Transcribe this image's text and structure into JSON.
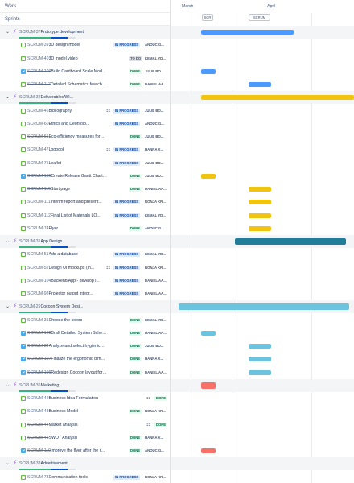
{
  "header": {
    "work_label": "Work",
    "sprints_label": "Sprints"
  },
  "timeline": {
    "months": [
      "March",
      "April"
    ],
    "sprints": [
      "SCR",
      "SCRUM"
    ]
  },
  "rows": [
    {
      "kind": "epic",
      "key": "SCRUM-37",
      "title": "Prototype development",
      "color": "#4c9aff"
    },
    {
      "kind": "story",
      "key": "SCRUM-39",
      "title": "3D design model",
      "status": "IN PROGRESS",
      "status_class": "inprogress",
      "assignee": "ANOUC G..."
    },
    {
      "kind": "story",
      "key": "SCRUM-40",
      "title": "3D model video",
      "status": "TO DO",
      "status_class": "todo",
      "assignee": "KEMAL YD..."
    },
    {
      "kind": "task",
      "key": "SCRUM-109",
      "title": "Build Cardboard Scale Mod...",
      "status": "DONE",
      "status_class": "done",
      "assignee": "JULIE BO...",
      "done": true
    },
    {
      "kind": "story",
      "key": "SCRUM-117",
      "title": "Detailed Schematics few chang...",
      "status": "DONE",
      "status_class": "done",
      "assignee": "DANIEL AA...",
      "done": true
    },
    {
      "kind": "epic",
      "key": "SCRUM-32",
      "title": "Deliverables/Wi...",
      "color": "#f1c40f"
    },
    {
      "kind": "story",
      "key": "SCRUM-46",
      "title": "Bibliography",
      "status": "IN PROGRESS",
      "status_class": "inprogress",
      "assignee": "JULIE BO...",
      "children": true
    },
    {
      "kind": "story",
      "key": "SCRUM-60",
      "title": "Ethics and Deontolo...",
      "status": "IN PROGRESS",
      "status_class": "inprogress",
      "assignee": "ANOUC G..."
    },
    {
      "kind": "story",
      "key": "SCRUM-61",
      "title": "Eco-efficiency measures for Sustai...",
      "status": "DONE",
      "status_class": "done",
      "assignee": "JULIE BO...",
      "done": true
    },
    {
      "kind": "story",
      "key": "SCRUM-47",
      "title": "Logbook",
      "status": "IN PROGRESS",
      "status_class": "inprogress",
      "assignee": "HANNA K...",
      "children": true
    },
    {
      "kind": "story",
      "key": "SCRUM-75",
      "title": "Leaflet",
      "status": "IN PROGRESS",
      "status_class": "inprogress",
      "assignee": "JULIE BO..."
    },
    {
      "kind": "task",
      "key": "SCRUM-105",
      "title": "Create Release Gantt Chart & Sp...",
      "status": "DONE",
      "status_class": "done",
      "assignee": "JULIE BO...",
      "done": true
    },
    {
      "kind": "story",
      "key": "SCRUM-115",
      "title": "Start page",
      "status": "DONE",
      "status_class": "done",
      "assignee": "DANIEL AA...",
      "done": true
    },
    {
      "kind": "story",
      "key": "SCRUM-111",
      "title": "Interim report and present...",
      "status": "IN PROGRESS",
      "status_class": "inprogress",
      "assignee": "RONJA KR..."
    },
    {
      "kind": "story",
      "key": "SCRUM-112",
      "title": "Final List of Materials LO...",
      "status": "IN PROGRESS",
      "status_class": "inprogress",
      "assignee": "KEMAL YD..."
    },
    {
      "kind": "story",
      "key": "SCRUM-74",
      "title": "Flyer",
      "status": "DONE",
      "status_class": "done",
      "assignee": "ANOUC G..."
    },
    {
      "kind": "epic",
      "key": "SCRUM-31",
      "title": "App Design",
      "color": "#227d9b"
    },
    {
      "kind": "story",
      "key": "SCRUM-51",
      "title": "Add a database",
      "status": "IN PROGRESS",
      "status_class": "inprogress",
      "assignee": "KEMAL YD..."
    },
    {
      "kind": "story",
      "key": "SCRUM-52",
      "title": "Design UI mockups (in...",
      "status": "IN PROGRESS",
      "status_class": "inprogress",
      "assignee": "RONJA KR...",
      "children": true
    },
    {
      "kind": "story",
      "key": "SCRUM-104",
      "title": "Backend App - develop l...",
      "status": "IN PROGRESS",
      "status_class": "inprogress",
      "assignee": "DANIEL AA..."
    },
    {
      "kind": "story",
      "key": "SCRUM-98",
      "title": "Projector output integr...",
      "status": "IN PROGRESS",
      "status_class": "inprogress",
      "assignee": "DANIEL AA..."
    },
    {
      "kind": "epic",
      "key": "SCRUM-29",
      "title": "Cocoon System Desi...",
      "color": "#6cc3e0"
    },
    {
      "kind": "story",
      "key": "SCRUM-35",
      "title": "Choose the colors",
      "status": "DONE",
      "status_class": "done",
      "assignee": "KEMAL YD...",
      "done": true
    },
    {
      "kind": "task",
      "key": "SCRUM-108",
      "title": "Draft Detailed System Schemat...",
      "status": "DONE",
      "status_class": "done",
      "assignee": "DANIEL AA...",
      "done": true
    },
    {
      "kind": "task",
      "key": "SCRUM-34",
      "title": "Analyze and select hygienic/acous...",
      "status": "DONE",
      "status_class": "done",
      "assignee": "JULIE BO...",
      "done": true
    },
    {
      "kind": "task",
      "key": "SCRUM-107",
      "title": "Finalize the ergonomic dimensions",
      "status": "DONE",
      "status_class": "done",
      "assignee": "HANNA K...",
      "done": true
    },
    {
      "kind": "task",
      "key": "SCRUM-106",
      "title": "Redesign Cocoon layout for wh...",
      "status": "DONE",
      "status_class": "done",
      "assignee": "DANIEL AA...",
      "done": true
    },
    {
      "kind": "epic",
      "key": "SCRUM-36",
      "title": "Marketing",
      "color": "#f87168"
    },
    {
      "kind": "story",
      "key": "SCRUM-42",
      "title": "Business Idea Formulation",
      "status": "DONE",
      "status_class": "done",
      "assignee": "",
      "done": true,
      "children": true
    },
    {
      "kind": "story",
      "key": "SCRUM-43",
      "title": "Business Model",
      "status": "DONE",
      "status_class": "done",
      "assignee": "RONJA KR...",
      "done": true
    },
    {
      "kind": "story",
      "key": "SCRUM-44",
      "title": "Market analysis",
      "status": "DONE",
      "status_class": "done",
      "assignee": "",
      "done": true,
      "children": true
    },
    {
      "kind": "story",
      "key": "SCRUM-45",
      "title": "SWOT Analysis",
      "status": "DONE",
      "status_class": "done",
      "assignee": "HANNA K...",
      "done": true
    },
    {
      "kind": "task",
      "key": "SCRUM-110",
      "title": "Improve the flyer after the recieve...",
      "status": "DONE",
      "status_class": "done",
      "assignee": "ANOUC G...",
      "done": true
    },
    {
      "kind": "epic",
      "key": "SCRUM-38",
      "title": "Advertisement",
      "color": "#6554c0"
    },
    {
      "kind": "story",
      "key": "SCRUM-73",
      "title": "Communication tools",
      "status": "IN PROGRESS",
      "status_class": "inprogress",
      "assignee": "RONJA KR..."
    }
  ]
}
